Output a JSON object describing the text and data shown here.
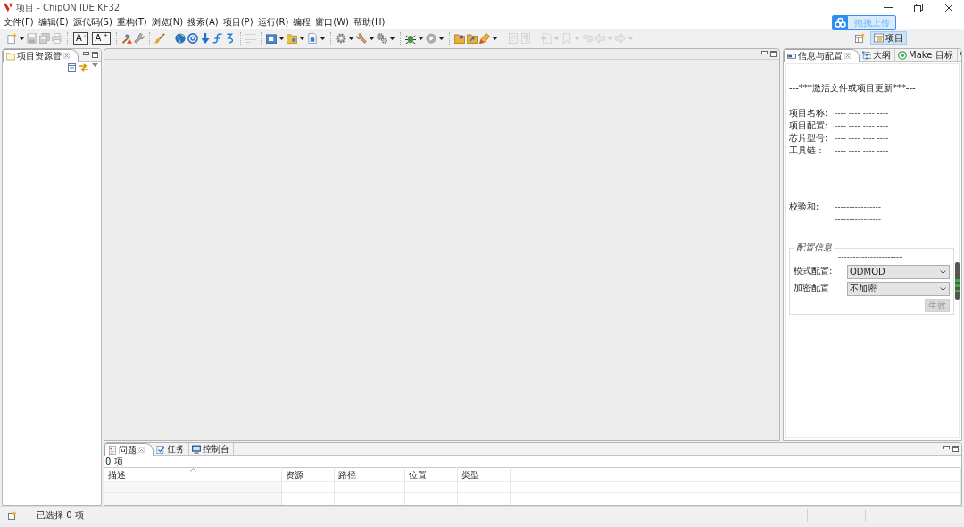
{
  "window": {
    "title": "项目 - ChipON IDE KF32"
  },
  "menu": [
    {
      "label": "文件(F)"
    },
    {
      "label": "编辑(E)"
    },
    {
      "label": "源代码(S)"
    },
    {
      "label": "重构(T)"
    },
    {
      "label": "浏览(N)"
    },
    {
      "label": "搜索(A)"
    },
    {
      "label": "项目(P)"
    },
    {
      "label": "运行(R)"
    },
    {
      "label": "编程"
    },
    {
      "label": "窗口(W)"
    },
    {
      "label": "帮助(H)"
    }
  ],
  "toolbar": [
    [
      {
        "dropdown": true,
        "disabled": false
      },
      {
        "dropdown": false,
        "disabled": true
      },
      {
        "dropdown": false,
        "disabled": true
      },
      {
        "dropdown": false,
        "disabled": true
      }
    ],
    [
      {
        "label": "A$^{-}$",
        "dropdown": false,
        "disabled": false
      },
      {
        "label": "A$^{+}$",
        "dropdown": false,
        "disabled": false
      }
    ],
    [
      {
        "dropdown": false,
        "disabled": false
      },
      {
        "dropdown": false,
        "disabled": false
      }
    ],
    [
      {
        "dropdown": false,
        "disabled": false
      }
    ],
    [
      {
        "dropdown": false,
        "disabled": false
      },
      {
        "dropdown": false,
        "disabled": false
      },
      {
        "dropdown": false,
        "disabled": false
      },
      {
        "dropdown": false,
        "disabled": false
      },
      {
        "dropdown": false,
        "disabled": false
      }
    ],
    [
      {
        "dropdown": false,
        "disabled": true
      }
    ],
    [
      {
        "dropdown": true,
        "disabled": false
      },
      {
        "dropdown": true,
        "disabled": false
      },
      {
        "dropdown": true,
        "disabled": false
      }
    ],
    [
      {
        "dropdown": true,
        "disabled": false
      },
      {
        "dropdown": true,
        "disabled": false
      },
      {
        "dropdown": true,
        "disabled": false
      }
    ],
    [
      {
        "dropdown": true,
        "disabled": false
      },
      {
        "dropdown": true,
        "disabled": false
      }
    ],
    [
      {
        "dropdown": false,
        "disabled": false
      },
      {
        "dropdown": false,
        "disabled": false
      },
      {
        "dropdown": true,
        "disabled": false
      }
    ],
    [
      {
        "dropdown": false,
        "disabled": true
      },
      {
        "dropdown": false,
        "disabled": true
      }
    ],
    [
      {
        "dropdown": true,
        "disabled": true
      },
      {
        "dropdown": true,
        "disabled": true
      },
      {
        "dropdown": false,
        "disabled": true
      },
      {
        "dropdown": true,
        "disabled": true
      },
      {
        "dropdown": true,
        "disabled": true
      }
    ]
  ],
  "upload_widget": {
    "label": "拖拽上传"
  },
  "perspectives": [
    {
      "label": "项目",
      "selected": true
    }
  ],
  "project_explorer": {
    "tabs": [
      {
        "label": "项目资源管",
        "selected": true
      }
    ]
  },
  "info_panel": {
    "tabs": [
      {
        "label": "信息与配置",
        "selected": true
      },
      {
        "label": "大纲",
        "selected": false
      },
      {
        "label": "Make 目标",
        "selected": false
      }
    ],
    "notice": "---***激活文件或项目更新***---",
    "fields": {
      "labels": [
        "项目名称:",
        "项目配置:",
        "芯片型号:",
        "工具链 :"
      ],
      "values": [
        "---- ---- ---- ----",
        "---- ---- ---- ----",
        "---- ---- ---- ----",
        "---- ---- ---- ----"
      ]
    },
    "checksum": {
      "label": "校验和:",
      "lines": [
        "----------------",
        "----------------"
      ]
    },
    "config": {
      "legend": "配置信息",
      "separator": "----------------------",
      "selects": [
        {
          "label": "模式配置:",
          "value": "ODMOD"
        },
        {
          "label": "加密配置",
          "value": "不加密"
        }
      ],
      "apply_button": {
        "label": "生效",
        "disabled": true
      }
    }
  },
  "problems_panel": {
    "tabs": [
      {
        "label": "问题",
        "selected": true
      },
      {
        "label": "任务",
        "selected": false
      },
      {
        "label": "控制台",
        "selected": false
      }
    ],
    "count": "0 项",
    "columns": [
      {
        "label": "描述",
        "sorted": true
      },
      {
        "label": "资源",
        "sorted": false
      },
      {
        "label": "路径",
        "sorted": false
      },
      {
        "label": "位置",
        "sorted": false
      },
      {
        "label": "类型",
        "sorted": false
      }
    ]
  },
  "status_bar": {
    "text": "已选择 0 项"
  }
}
